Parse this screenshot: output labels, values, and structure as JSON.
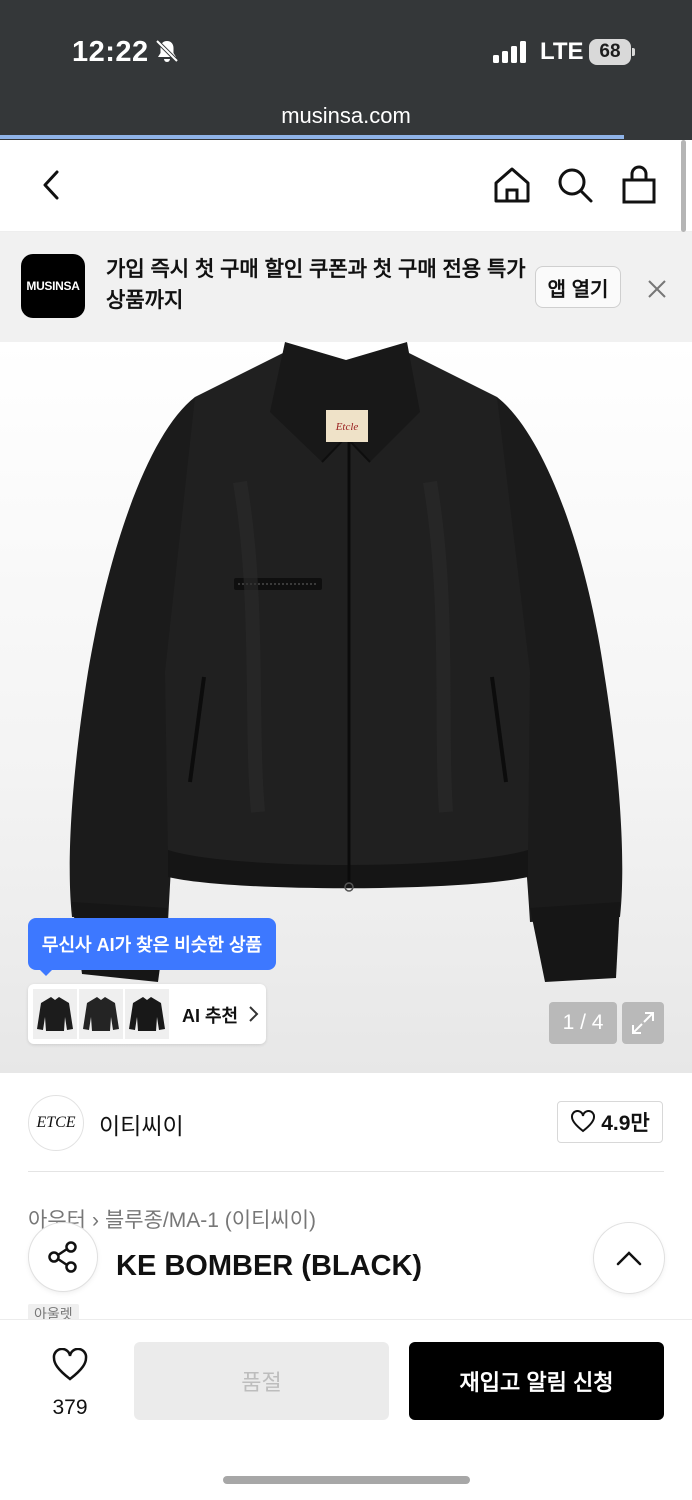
{
  "status_bar": {
    "time": "12:22",
    "network": "LTE",
    "battery": "68",
    "icons": [
      "bell-slash-icon",
      "signal-icon",
      "battery-icon"
    ]
  },
  "browser": {
    "url": "musinsa.com",
    "load_progress_percent": 90
  },
  "nav": {
    "icons": [
      "back-arrow-icon",
      "home-icon",
      "search-icon",
      "shopping-bag-icon"
    ]
  },
  "app_banner": {
    "logo_text": "MUSINSA",
    "message": "가입 즉시 첫 구매 할인 쿠폰과 첫 구매 전용 특가 상품까지",
    "open_app_label": "앱 열기"
  },
  "gallery": {
    "ai_tooltip": "무신사 AI가 찾은 비슷한 상품",
    "ai_recommend_label": "AI 추천",
    "page_indicator": "1 / 4",
    "colors": {
      "jacket": "#1c1c1c",
      "tooltip": "#3d78ff"
    }
  },
  "brand": {
    "logo_text": "ETCE",
    "name": "이티씨이",
    "likes": "4.9만"
  },
  "product": {
    "breadcrumb": [
      "아우터",
      "블루종/MA-1 (이티씨이)"
    ],
    "title": "KE BOMBER (BLACK)",
    "tag": "아울렛"
  },
  "bottom_bar": {
    "wish_count": "379",
    "soldout_label": "품절",
    "restock_label": "재입고 알림 신청"
  }
}
